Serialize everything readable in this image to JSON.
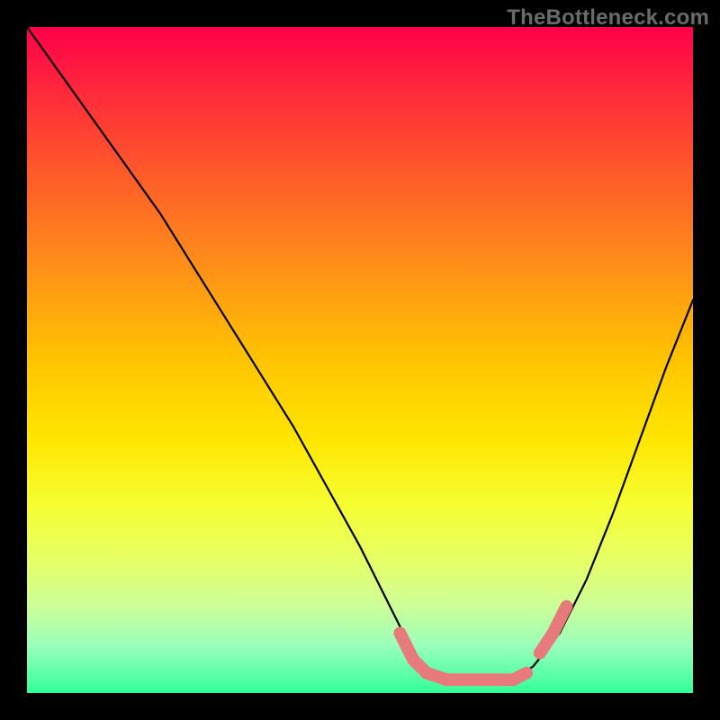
{
  "watermark": "TheBottleneck.com",
  "colors": {
    "highlight": "#e77b7b",
    "curve": "#000000",
    "background_border": "#000000"
  },
  "chart_data": {
    "type": "line",
    "title": "",
    "xlabel": "",
    "ylabel": "",
    "xlim": [
      0,
      100
    ],
    "ylim": [
      0,
      100
    ],
    "grid": false,
    "legend": false,
    "series": [
      {
        "name": "bottleneck-curve",
        "x": [
          0,
          5,
          10,
          15,
          20,
          25,
          30,
          35,
          40,
          45,
          50,
          55,
          58,
          60,
          63,
          66,
          70,
          73,
          76,
          80,
          84,
          88,
          92,
          96,
          100
        ],
        "y": [
          100,
          93,
          86,
          79,
          72,
          64,
          56,
          48,
          40,
          31,
          22,
          12,
          6,
          3,
          2,
          2,
          2,
          2,
          4,
          9,
          17,
          27,
          38,
          49,
          59
        ]
      }
    ],
    "highlights": [
      {
        "name": "trough",
        "x": [
          56,
          58,
          60,
          63,
          66,
          70,
          73,
          75
        ],
        "y": [
          9,
          5,
          3,
          2,
          2,
          2,
          2,
          3
        ]
      },
      {
        "name": "right-rise",
        "x": [
          77,
          79,
          81
        ],
        "y": [
          6,
          9,
          13
        ]
      }
    ]
  }
}
